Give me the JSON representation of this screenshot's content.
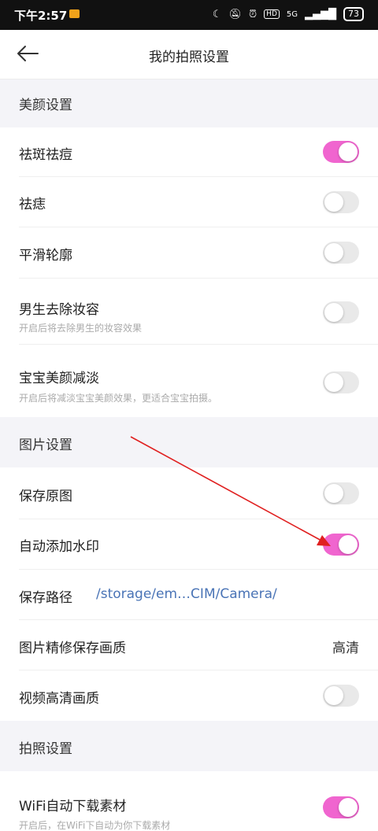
{
  "status": {
    "time": "下午2:57",
    "net": "5G",
    "battery": "73"
  },
  "header": {
    "title": "我的拍照设置"
  },
  "colors": {
    "accent": "#f065cf",
    "link": "#4a74b6",
    "arrow": "#e02020"
  },
  "beauty": {
    "section_title": "美颜设置",
    "items": [
      {
        "label": "祛斑祛痘",
        "enabled": true
      },
      {
        "label": "祛痣",
        "enabled": false
      },
      {
        "label": "平滑轮廓",
        "enabled": false
      },
      {
        "label": "男生去除妆容",
        "desc": "开启后将去除男生的妆容效果",
        "enabled": false
      },
      {
        "label": "宝宝美颜减淡",
        "desc": "开启后将减淡宝宝美颜效果，更适合宝宝拍摄。",
        "enabled": false
      }
    ]
  },
  "picture": {
    "section_title": "图片设置",
    "save_original": {
      "label": "保存原图",
      "enabled": false
    },
    "watermark": {
      "label": "自动添加水印",
      "enabled": true
    },
    "save_path": {
      "label": "保存路径",
      "value": "/storage/em…CIM/Camera/"
    },
    "retouch_quality": {
      "label": "图片精修保存画质",
      "value": "高清"
    },
    "video_hd": {
      "label": "视频高清画质",
      "enabled": false
    }
  },
  "photo": {
    "section_title": "拍照设置",
    "wifi_download": {
      "label": "WiFi自动下载素材",
      "desc": "开启后，在WiFi下自动为你下载素材",
      "enabled": true
    }
  }
}
